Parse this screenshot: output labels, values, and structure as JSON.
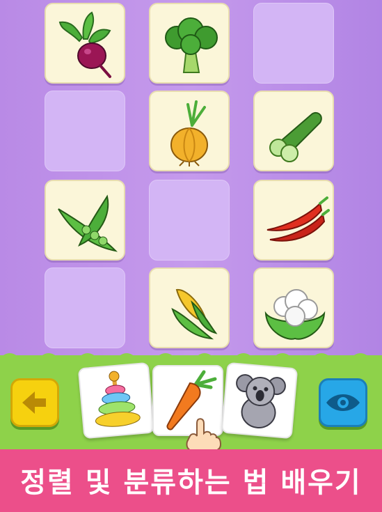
{
  "title_banner": {
    "text": "정렬 및 분류하는 법 배우기"
  },
  "grid": {
    "cards": [
      {
        "icon": "beet-icon",
        "state": "filled"
      },
      {
        "icon": "broccoli-icon",
        "state": "filled"
      },
      {
        "icon": "",
        "state": "empty"
      },
      {
        "icon": "",
        "state": "empty"
      },
      {
        "icon": "onion-icon",
        "state": "filled"
      },
      {
        "icon": "cucumber-icon",
        "state": "filled"
      },
      {
        "icon": "peas-icon",
        "state": "filled"
      },
      {
        "icon": "",
        "state": "empty"
      },
      {
        "icon": "chili-pepper-icon",
        "state": "filled"
      },
      {
        "icon": "",
        "state": "empty"
      },
      {
        "icon": "corn-icon",
        "state": "filled"
      },
      {
        "icon": "cauliflower-icon",
        "state": "filled"
      }
    ]
  },
  "tray": {
    "items": [
      "ring-stacker-toy-icon",
      "carrot-icon",
      "koala-toy-icon"
    ]
  },
  "controls": {
    "back": "back-arrow-icon",
    "peek": "eye-icon"
  },
  "colors": {
    "background": "#c59aec",
    "grass": "#8ed24a",
    "banner": "#ec4f8a",
    "card": "#fbf6d9"
  }
}
